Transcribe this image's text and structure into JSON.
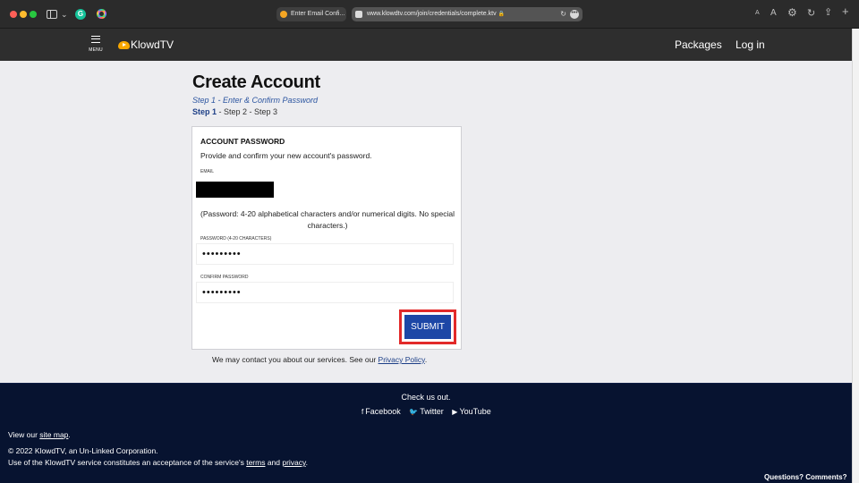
{
  "browser": {
    "tab_title": "Enter Email Confi...",
    "url": "www.klowdtv.com/join/credentials/complete.ktv",
    "url_lock": "🔒",
    "text_size_small": "A",
    "text_size_large": "A"
  },
  "header": {
    "menu_label": "MENU",
    "logo_text": "KlowdTV",
    "nav": [
      "Packages",
      "Log in"
    ]
  },
  "page": {
    "title": "Create Account",
    "step_subtitle": "Step 1 - Enter & Confirm Password",
    "steps": {
      "current": "Step 1",
      "rest": " - Step 2 - Step 3"
    }
  },
  "form": {
    "heading": "ACCOUNT PASSWORD",
    "description": "Provide and confirm your new account's password.",
    "email_label": "EMAIL",
    "password_note": "(Password: 4-20 alphabetical characters and/or numerical digits. No special characters.)",
    "password_label": "PASSWORD (4-20 CHARACTERS)",
    "password_value": "•••••••••",
    "confirm_label": "CONFIRM PASSWORD",
    "confirm_value": "•••••••••",
    "submit_label": "SUBMIT"
  },
  "contact": {
    "text": "We may contact you about our services. See our ",
    "link": "Privacy Policy",
    "end": "."
  },
  "footer": {
    "check_us": "Check us out.",
    "socials": [
      {
        "icon": "facebook-icon",
        "glyph": "f",
        "label": "Facebook"
      },
      {
        "icon": "twitter-icon",
        "glyph": "🐦",
        "label": "Twitter"
      },
      {
        "icon": "youtube-icon",
        "glyph": "▶",
        "label": "YouTube"
      }
    ],
    "site_map_prefix": "View our ",
    "site_map_link": "site map",
    "site_map_suffix": ".",
    "copyright": "© 2022 KlowdTV, an Un-Linked Corporation.",
    "terms_prefix": "Use of the KlowdTV service constitutes an acceptance of the service's ",
    "terms_link": "terms",
    "terms_and": " and ",
    "privacy_link": "privacy",
    "terms_suffix": ".",
    "questions": "Questions? Comments?"
  },
  "colors": {
    "accent": "#1d47a6",
    "highlight_outline": "#e22a2a",
    "footer_bg": "#071330",
    "header_bg": "#2e2e2e"
  }
}
